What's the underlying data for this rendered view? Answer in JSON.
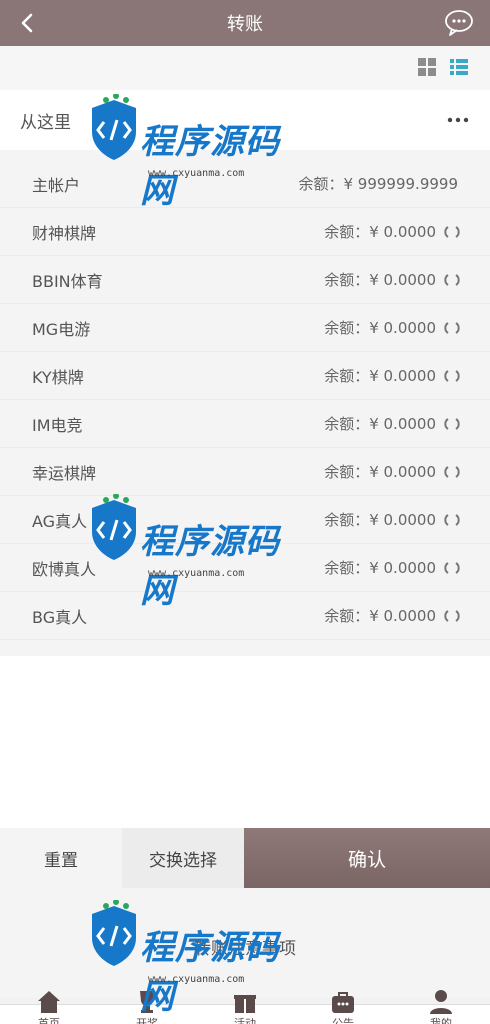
{
  "header": {
    "title": "转账",
    "back_icon": "chevron-left-icon",
    "chat_icon": "chat-bubble-icon"
  },
  "view_toggle": {
    "grid_icon": "grid-view-icon",
    "list_icon": "list-view-icon",
    "active_color": "#3aa8c8"
  },
  "from": {
    "label": "从这里",
    "more_icon": "more-horizontal-icon"
  },
  "wallets": [
    {
      "name": "主帐户",
      "balance_label": "余额：",
      "balance": "¥ 999999.9999",
      "refresh": false
    },
    {
      "name": "财神棋牌",
      "balance_label": "余额：",
      "balance": "¥ 0.0000",
      "refresh": true
    },
    {
      "name": "BBIN体育",
      "balance_label": "余额：",
      "balance": "¥ 0.0000",
      "refresh": true
    },
    {
      "name": "MG电游",
      "balance_label": "余额：",
      "balance": "¥ 0.0000",
      "refresh": true
    },
    {
      "name": "KY棋牌",
      "balance_label": "余额：",
      "balance": "¥ 0.0000",
      "refresh": true
    },
    {
      "name": "IM电竞",
      "balance_label": "余额：",
      "balance": "¥ 0.0000",
      "refresh": true
    },
    {
      "name": "幸运棋牌",
      "balance_label": "余额：",
      "balance": "¥ 0.0000",
      "refresh": true
    },
    {
      "name": "AG真人",
      "balance_label": "余额：",
      "balance": "¥ 0.0000",
      "refresh": true
    },
    {
      "name": "欧博真人",
      "balance_label": "余额：",
      "balance": "¥ 0.0000",
      "refresh": true
    },
    {
      "name": "BG真人",
      "balance_label": "余额：",
      "balance": "¥ 0.0000",
      "refresh": true
    }
  ],
  "actions": {
    "reset": "重置",
    "swap": "交换选择",
    "confirm": "确认"
  },
  "notice": {
    "title": "转账注意事项"
  },
  "tabbar": [
    {
      "label": "首页",
      "icon": "home-icon"
    },
    {
      "label": "开奖",
      "icon": "trophy-icon"
    },
    {
      "label": "活动",
      "icon": "gift-icon"
    },
    {
      "label": "公告",
      "icon": "notice-bag-icon"
    },
    {
      "label": "我的",
      "icon": "user-icon"
    }
  ],
  "watermark": {
    "text": "程序源码网",
    "url": "www.cxyuanma.com"
  },
  "colors": {
    "brand": "#8a7676",
    "watermark_blue": "#1778c9",
    "watermark_green": "#27a85a"
  }
}
